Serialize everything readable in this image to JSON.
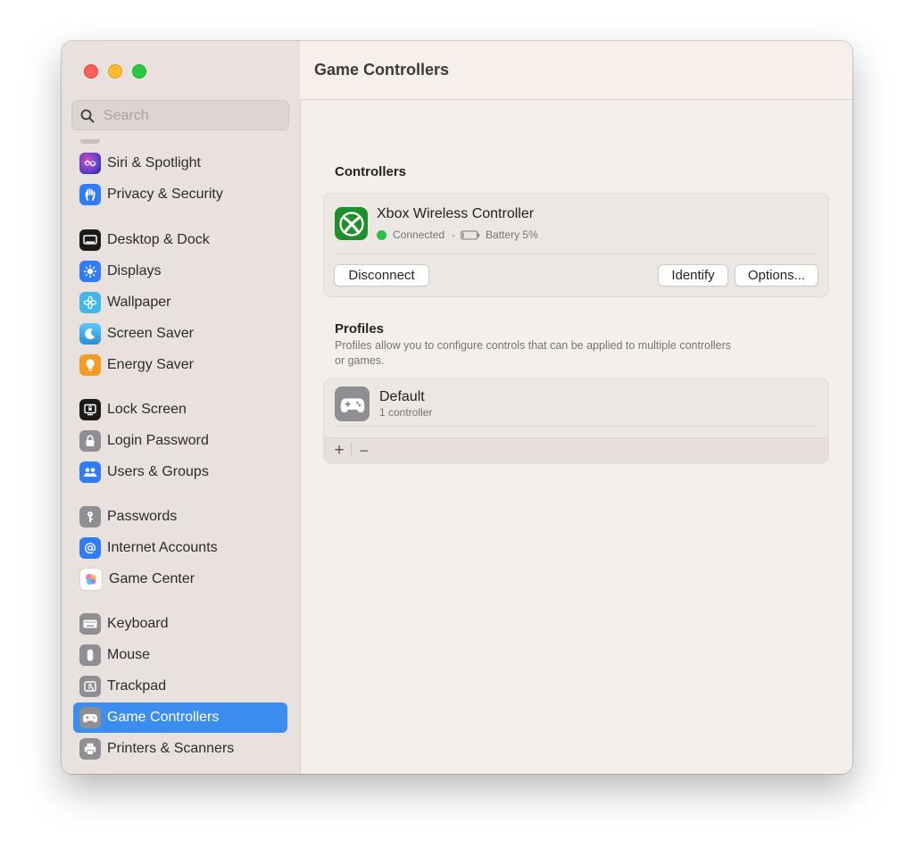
{
  "window": {
    "title": "Game Controllers"
  },
  "search": {
    "placeholder": "Search"
  },
  "sidebar": {
    "items": [
      {
        "label": "Siri & Spotlight",
        "icon": "siri-icon",
        "color": "#6b3fd6"
      },
      {
        "label": "Privacy & Security",
        "icon": "hand-icon",
        "color": "#2f7cf6"
      },
      {
        "label": "Desktop & Dock",
        "icon": "dock-icon",
        "color": "#1b1b1b"
      },
      {
        "label": "Displays",
        "icon": "sun-icon",
        "color": "#2f7cf6"
      },
      {
        "label": "Wallpaper",
        "icon": "flower-icon",
        "color": "#3fb7e8"
      },
      {
        "label": "Screen Saver",
        "icon": "moon-icon",
        "color": "#36a7e0"
      },
      {
        "label": "Energy Saver",
        "icon": "bulb-icon",
        "color": "#f59a23"
      },
      {
        "label": "Lock Screen",
        "icon": "lock-screen-icon",
        "color": "#1b1b1b"
      },
      {
        "label": "Login Password",
        "icon": "lock-icon",
        "color": "#8e8e93"
      },
      {
        "label": "Users & Groups",
        "icon": "users-icon",
        "color": "#2f7cf6"
      },
      {
        "label": "Passwords",
        "icon": "key-icon",
        "color": "#8e8e93"
      },
      {
        "label": "Internet Accounts",
        "icon": "at-icon",
        "color": "#2f7cf6"
      },
      {
        "label": "Game Center",
        "icon": "game-center-icon",
        "color": "#ffffff"
      },
      {
        "label": "Keyboard",
        "icon": "keyboard-icon",
        "color": "#8e8e93"
      },
      {
        "label": "Mouse",
        "icon": "mouse-icon",
        "color": "#8e8e93"
      },
      {
        "label": "Trackpad",
        "icon": "trackpad-icon",
        "color": "#8e8e93"
      },
      {
        "label": "Game Controllers",
        "icon": "gamepad-icon",
        "color": "#8e8e93",
        "selected": true
      },
      {
        "label": "Printers & Scanners",
        "icon": "printer-icon",
        "color": "#8e8e93"
      }
    ]
  },
  "controllers": {
    "heading": "Controllers",
    "device": {
      "name": "Xbox Wireless Controller",
      "status": "Connected",
      "separator": "-",
      "battery": "Battery 5%",
      "status_color": "#2dc246",
      "icon": "xbox-icon",
      "icon_color": "#1e8f2c"
    },
    "buttons": {
      "disconnect": "Disconnect",
      "identify": "Identify",
      "options": "Options..."
    }
  },
  "profiles": {
    "heading": "Profiles",
    "description_line1": "Profiles allow you to configure controls that can be applied to multiple controllers",
    "description_line2": "or games.",
    "items": [
      {
        "name": "Default",
        "detail": "1 controller",
        "icon": "gamepad-icon"
      }
    ],
    "add_label": "+",
    "remove_label": "−"
  }
}
